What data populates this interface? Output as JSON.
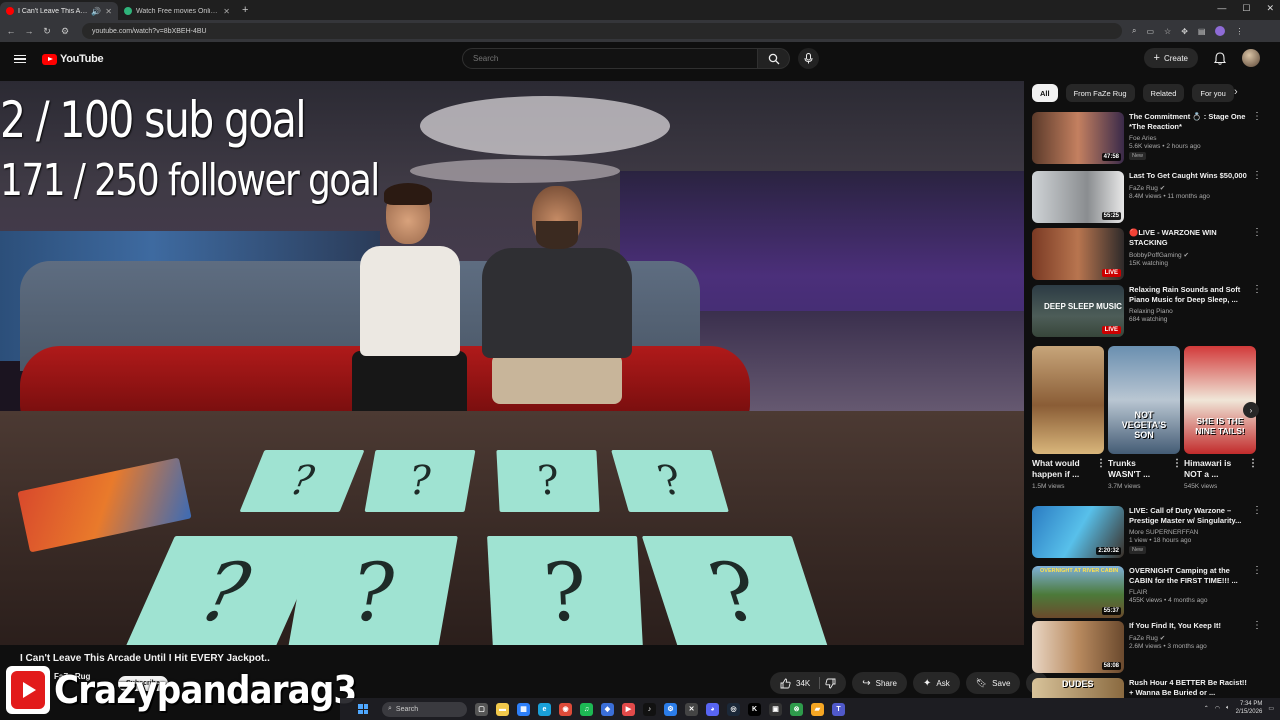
{
  "browser": {
    "tabs": [
      {
        "title": "I Can't Leave This Arcade U",
        "active": true
      },
      {
        "title": "Watch Free movies Online | 12",
        "active": false
      }
    ],
    "url": "youtube.com/watch?v=8bXBEH-4BU"
  },
  "header": {
    "logo_text": "YouTube",
    "search_placeholder": "Search",
    "create_label": "Create"
  },
  "player": {
    "overlay_line1": "2 / 100 sub goal",
    "overlay_line2": "171 / 250 follower goal",
    "card_symbol": "?"
  },
  "video": {
    "title": "I Can't Leave This Arcade Until I Hit EVERY Jackpot..",
    "channel": "FaZe Rug",
    "subscribe_label": "Subscribe",
    "likes": "34K",
    "share_label": "Share",
    "ask_label": "Ask",
    "save_label": "Save"
  },
  "watermark": {
    "text": "Crazypandarag3"
  },
  "sidebar": {
    "chips": [
      "All",
      "From FaZe Rug",
      "Related",
      "For you"
    ],
    "recommendations": [
      {
        "title": "The Commitment 💍 : Stage One *The Reaction*",
        "channel": "Foe Aries",
        "stats": "5.6K views • 2 hours ago",
        "badge": "New",
        "duration": "47:58",
        "live": false
      },
      {
        "title": "Last To Get Caught Wins $50,000",
        "channel": "FaZe Rug",
        "stats": "8.4M views • 11 months ago",
        "badge": "",
        "duration": "55:25",
        "live": false
      },
      {
        "title": "🔴LIVE - WARZONE WIN STACKING",
        "channel": "BobbyPoffGaming",
        "stats": "15K watching",
        "badge": "",
        "duration": "LIVE",
        "live": true
      },
      {
        "title": "Relaxing Rain Sounds and Soft Piano Music for Deep Sleep, ...",
        "channel": "Relaxing Piano",
        "stats": "684 watching",
        "badge": "",
        "duration": "LIVE",
        "live": true
      },
      {
        "title": "LIVE: Call of Duty Warzone – Prestige Master w/ Singularity...",
        "channel": "More SUPERNERFFAN",
        "stats": "1 view • 18 hours ago",
        "badge": "New",
        "duration": "2:20:32",
        "live": false
      },
      {
        "title": "OVERNIGHT Camping at the CABIN for the FIRST TIME!!! ...",
        "channel": "FLAIR",
        "stats": "455K views • 4 months ago",
        "badge": "",
        "duration": "55:37",
        "live": false
      },
      {
        "title": "If You Find It, You Keep It!",
        "channel": "FaZe Rug",
        "stats": "2.6M views • 3 months ago",
        "badge": "",
        "duration": "58:08",
        "live": false
      },
      {
        "title": "Rush Hour 4 BETTER Be Racist!! + Wanna Be Buried or ...",
        "channel": "",
        "stats": "",
        "badge": "",
        "duration": "",
        "live": false
      }
    ],
    "shorts": [
      {
        "title": "What would happen if ...",
        "views": "1.5M views",
        "overlay": ""
      },
      {
        "title": "Trunks WASN'T ...",
        "views": "3.7M views",
        "overlay": "NOT VEGETA'S SON"
      },
      {
        "title": "Himawari is NOT a ...",
        "views": "545K views",
        "overlay": "SHE IS THE NINE TAILS!"
      }
    ],
    "thumb_texts": [
      "DEEP SLEEP MUSIC",
      "OVERNIGHT AT RIVER CABIN",
      "DUDES"
    ]
  },
  "taskbar": {
    "search_label": "Search",
    "time": "7:34 PM",
    "date": "2/15/2026"
  }
}
